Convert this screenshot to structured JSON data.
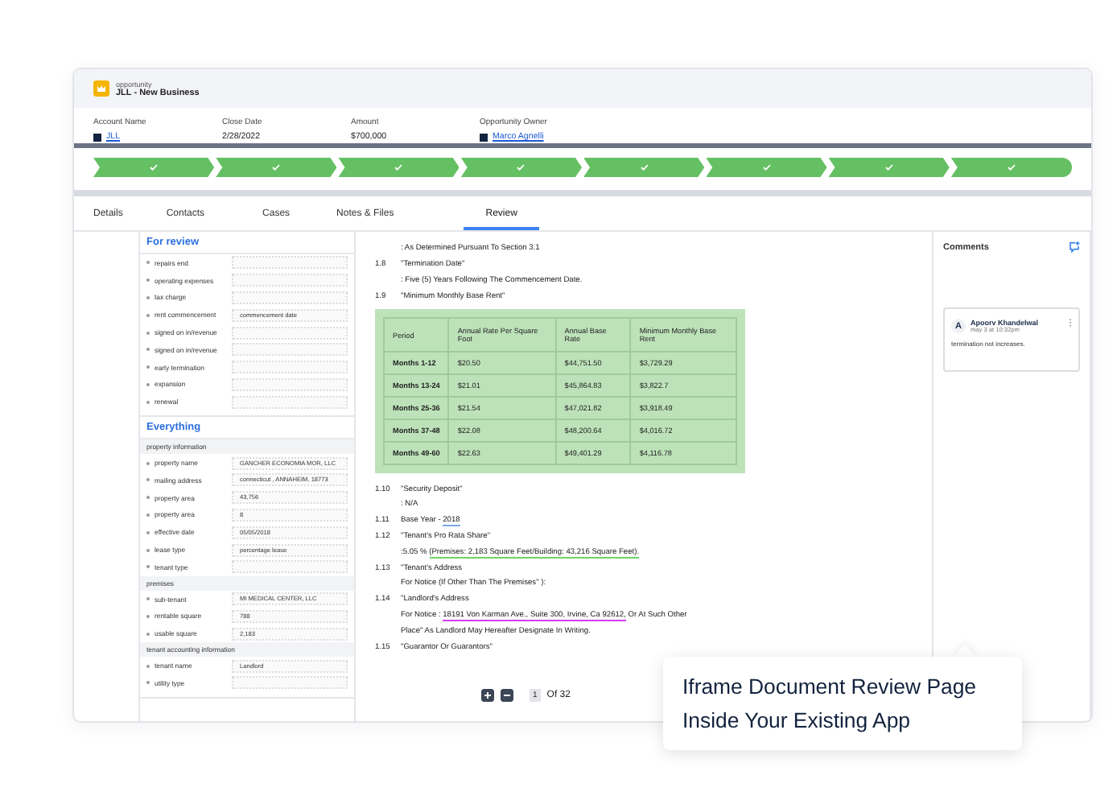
{
  "record": {
    "type_label": "opportunity",
    "title": "JLL - New Business"
  },
  "fields": [
    {
      "label": "Account Name",
      "value": "JLL",
      "kind": "link"
    },
    {
      "label": "Close Date",
      "value": "2/28/2022",
      "kind": "text"
    },
    {
      "label": "Amount",
      "value": "$700,000",
      "kind": "text"
    },
    {
      "label": "Opportunity Owner",
      "value": "Marco Agnelli",
      "kind": "link"
    }
  ],
  "path_steps": [
    {
      "completed": true
    },
    {
      "completed": true
    },
    {
      "completed": true
    },
    {
      "completed": true
    },
    {
      "completed": true
    },
    {
      "completed": true
    },
    {
      "completed": true
    },
    {
      "completed": true
    }
  ],
  "tabs": [
    {
      "label": "Details",
      "selected": false
    },
    {
      "label": "Contacts",
      "selected": false
    },
    {
      "label": "Cases",
      "selected": false
    },
    {
      "label": "Notes & Files",
      "selected": false
    },
    {
      "label": "Review",
      "selected": true
    }
  ],
  "review_panel": {
    "sections": [
      {
        "title": "For review",
        "groups": [
          {
            "rows": [
              {
                "label": "repairs end",
                "value": ""
              },
              {
                "label": "operating expenses",
                "value": ""
              },
              {
                "label": "tax charge",
                "value": ""
              },
              {
                "label": "rent commencement",
                "value": "commencement date"
              },
              {
                "label": "signed on in/revenue",
                "value": ""
              },
              {
                "label": "signed on in/revenue",
                "value": ""
              },
              {
                "label": "early termination",
                "value": ""
              },
              {
                "label": "expansion",
                "value": ""
              },
              {
                "label": "renewal",
                "value": ""
              }
            ]
          }
        ]
      },
      {
        "title": "Everything",
        "groups": [
          {
            "title": "property information",
            "rows": [
              {
                "label": "property name",
                "value": "GANCHER ECONOMIA MOR, LLC"
              },
              {
                "label": "mailing address",
                "value": "connecticut , ANNAHEIM, 18773"
              },
              {
                "label": "property area",
                "value": "43,756"
              },
              {
                "label": "property area",
                "value": "8"
              },
              {
                "label": "effective date",
                "value": "05/05/2018"
              },
              {
                "label": "lease type",
                "value": "percentage lease"
              },
              {
                "label": "tenant type",
                "value": ""
              }
            ]
          },
          {
            "title": "premises",
            "rows": [
              {
                "label": "sub-tenant",
                "value": "MI MEDICAL CENTER, LLC"
              },
              {
                "label": "rentable square",
                "value": "788"
              },
              {
                "label": "usable square",
                "value": "2,183"
              }
            ]
          },
          {
            "title": "tenant accounting information",
            "rows": [
              {
                "label": "tenant name",
                "value": "Landlord"
              },
              {
                "label": "utility type",
                "value": ""
              }
            ]
          }
        ]
      }
    ]
  },
  "document": {
    "before": [
      {
        "parts": [
          {
            "text": ": As Determined Pursuant To Section 3.1"
          }
        ]
      },
      {
        "num": "1.8",
        "parts": [
          {
            "text": "\"Termination Date\""
          }
        ]
      },
      {
        "parts": [
          {
            "text": ": Five (5) Years Following The Commencement Date."
          }
        ]
      },
      {
        "num": "1.9",
        "parts": [
          {
            "text": "\"Minimum Monthly Base Rent\""
          }
        ]
      }
    ],
    "table": {
      "columns": [
        "Period",
        "Annual Rate Per Square Foot",
        "Annual Base Rate",
        "Minimum Monthly Base Rent"
      ],
      "rows": [
        [
          "Months 1-12",
          "$20.50",
          "$44,751.50",
          "$3,729.29"
        ],
        [
          "Months 13-24",
          "$21.01",
          "$45,864.83",
          "$3,822.7"
        ],
        [
          "Months 25-36",
          "$21.54",
          "$47,021.82",
          "$3,918.49"
        ],
        [
          "Months 37-48",
          "$22.08",
          "$48,200.64",
          "$4,016.72"
        ],
        [
          "Months 49-60",
          "$22.63",
          "$49,401.29",
          "$4,116.78"
        ]
      ]
    },
    "after": [
      {
        "num": "1.10",
        "parts": [
          {
            "text": "\"Security Deposit\""
          }
        ]
      },
      {
        "parts": [
          {
            "text": ": N/A"
          }
        ]
      },
      {
        "num": "1.11",
        "parts": [
          {
            "text": "Base Year - "
          },
          {
            "text": "2018",
            "color": "#7aa7f0"
          }
        ]
      },
      {
        "num": "1.12",
        "parts": [
          {
            "text": "\"Tenant's Pro Rata Share\""
          }
        ]
      },
      {
        "parts": [
          {
            "text": ":5.05 % "
          },
          {
            "text": "(Premises: ",
            "color": "#6fd36a"
          },
          {
            "text": "2,183 Square Feet/Building: ",
            "color": "#6fd36a"
          },
          {
            "text": "43,216 Square Feet).",
            "color": "#6fd36a"
          }
        ]
      },
      {
        "num": "1.13",
        "parts": [
          {
            "text": "\"Tenant's Address"
          }
        ]
      },
      {
        "parts": [
          {
            "text": "For Notice (If Other Than The Premises\" ):"
          }
        ]
      },
      {
        "num": "1.14",
        "parts": [
          {
            "text": "\"Landlord's Address"
          }
        ]
      },
      {
        "parts": [
          {
            "text": "For Notice : "
          },
          {
            "text": "18191 Von Karman Ave., Suite 300, Irvine, Ca 92612,",
            "color": "#d23ef0"
          },
          {
            "text": " Or At Such Other"
          }
        ]
      },
      {
        "parts": [
          {
            "text": "Place\" As Landlord May Hereafter Designate In Writing."
          }
        ]
      },
      {
        "num": "1.15",
        "parts": [
          {
            "text": "\"Guarantor Or Guarantors\""
          }
        ]
      }
    ],
    "pagination": {
      "page": "1",
      "of": "Of 32"
    }
  },
  "comments": {
    "title": "Comments",
    "items": [
      {
        "initial": "A",
        "author": "Apoorv Khandelwal",
        "time": "may 3 at 10:32pm",
        "text": "termination not increases."
      }
    ]
  },
  "callout": {
    "text": "Iframe Document Review Page Inside Your Existing App"
  }
}
